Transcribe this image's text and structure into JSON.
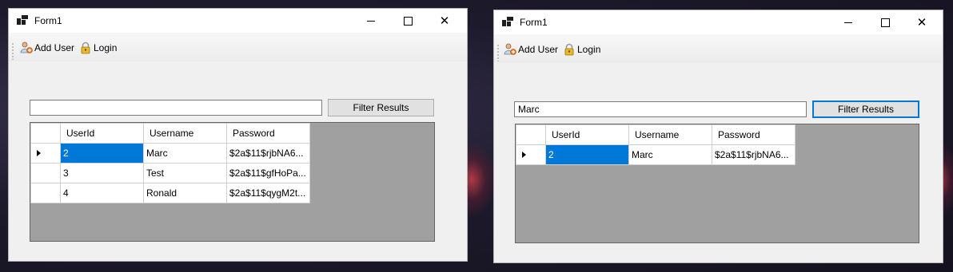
{
  "windows": [
    {
      "title": "Form1",
      "toolbar": {
        "add_user": "Add User",
        "login": "Login"
      },
      "filter": {
        "value": "",
        "button": "Filter Results"
      },
      "grid": {
        "columns": [
          "UserId",
          "Username",
          "Password"
        ],
        "rows": [
          [
            "2",
            "Marc",
            "$2a$11$rjbNA6..."
          ],
          [
            "3",
            "Test",
            "$2a$11$gfHoPa..."
          ],
          [
            "4",
            "Ronald",
            "$2a$11$qygM2t..."
          ]
        ],
        "selected_row": 0
      }
    },
    {
      "title": "Form1",
      "toolbar": {
        "add_user": "Add User",
        "login": "Login"
      },
      "filter": {
        "value": "Marc",
        "button": "Filter Results"
      },
      "grid": {
        "columns": [
          "UserId",
          "Username",
          "Password"
        ],
        "rows": [
          [
            "2",
            "Marc",
            "$2a$11$rjbNA6..."
          ]
        ],
        "selected_row": 0
      }
    }
  ],
  "colors": {
    "selection": "#0078d7",
    "grid_background": "#a0a0a0",
    "focus": "#0078d7"
  },
  "icons": {
    "app": "windows-form-icon",
    "add_user": "add-user-icon",
    "login": "padlock-icon"
  }
}
